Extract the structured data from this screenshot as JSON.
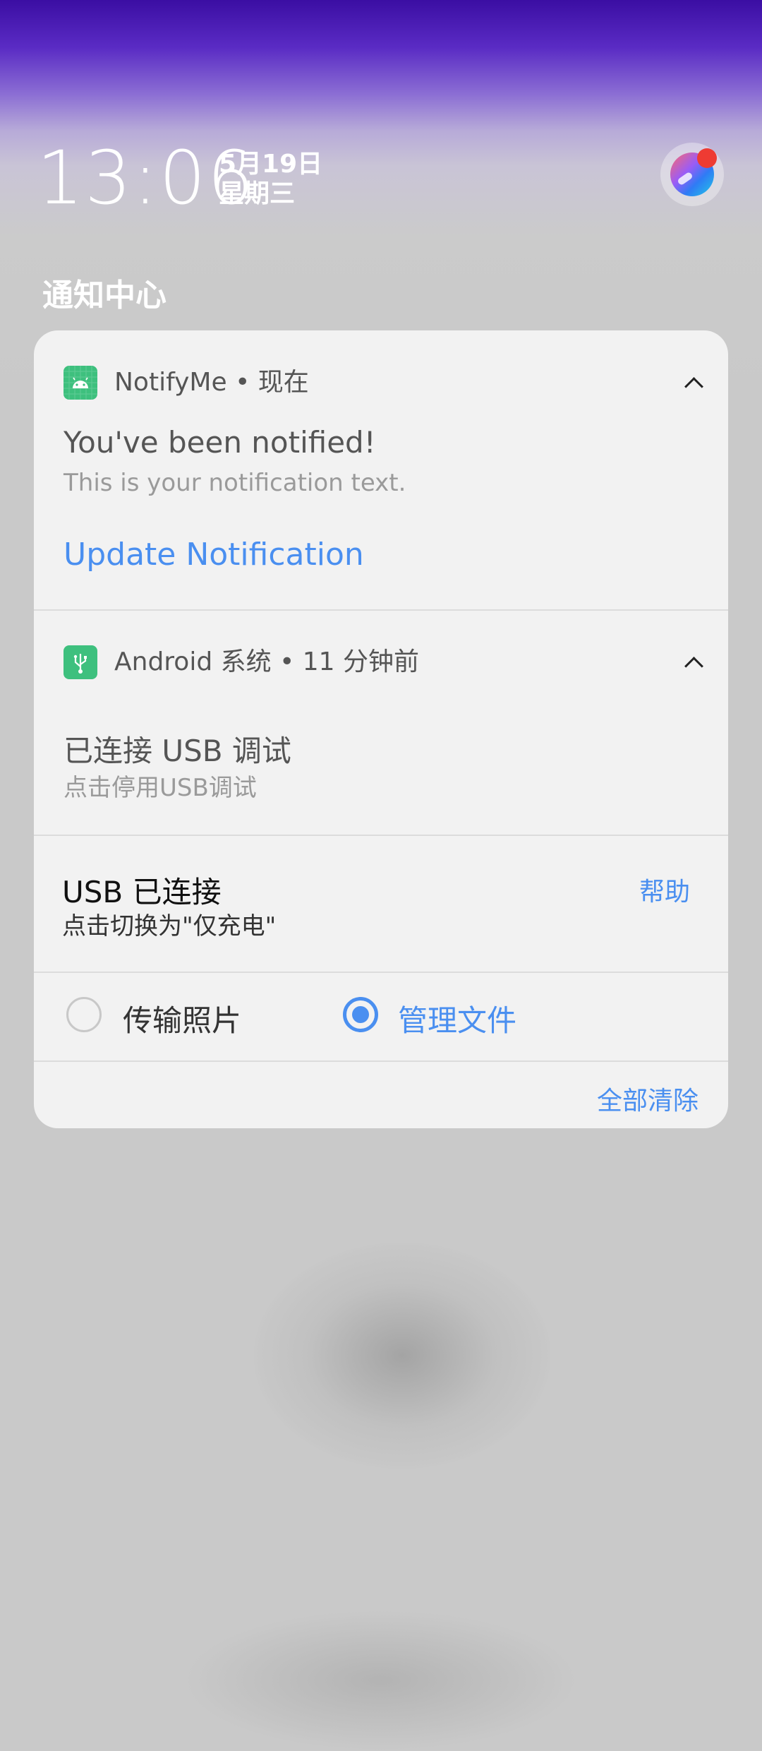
{
  "status": {
    "time": "13:06",
    "date": "5月19日",
    "weekday": "星期三"
  },
  "notification_center": {
    "title": "通知中心",
    "clear_all_label": "全部清除"
  },
  "notifications": [
    {
      "app": "NotifyMe",
      "time": "现在",
      "title": "You've been notified!",
      "text": "This is your notification text.",
      "action": "Update Notification"
    },
    {
      "app": "Android 系统",
      "time": "11 分钟前",
      "title": "已连接 USB 调试",
      "text": "点击停用USB调试"
    }
  ],
  "usb": {
    "title": "USB 已连接",
    "subtitle": "点击切换为\"仅充电\"",
    "help_label": "帮助",
    "options": [
      {
        "label": "传输照片",
        "selected": false
      },
      {
        "label": "管理文件",
        "selected": true
      }
    ]
  },
  "colors": {
    "accent": "#4a8ff0",
    "app_icon": "#3ec07e",
    "badge": "#ee3b33",
    "card_bg": "#f2f2f2",
    "wallpaper_top": "#3b0ea3"
  },
  "icons": {
    "notifyme": "android-icon",
    "android_system": "usb-icon",
    "expand": "chevron-up-icon",
    "avatar": "assistant-orb-icon"
  }
}
